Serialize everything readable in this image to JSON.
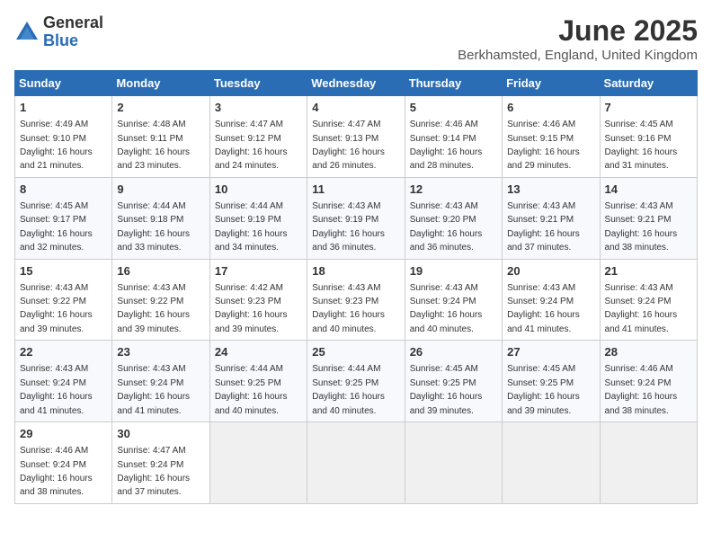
{
  "logo": {
    "general": "General",
    "blue": "Blue"
  },
  "title": "June 2025",
  "location": "Berkhamsted, England, United Kingdom",
  "weekdays": [
    "Sunday",
    "Monday",
    "Tuesday",
    "Wednesday",
    "Thursday",
    "Friday",
    "Saturday"
  ],
  "weeks": [
    [
      {
        "day": "1",
        "info": "Sunrise: 4:49 AM\nSunset: 9:10 PM\nDaylight: 16 hours and 21 minutes."
      },
      {
        "day": "2",
        "info": "Sunrise: 4:48 AM\nSunset: 9:11 PM\nDaylight: 16 hours and 23 minutes."
      },
      {
        "day": "3",
        "info": "Sunrise: 4:47 AM\nSunset: 9:12 PM\nDaylight: 16 hours and 24 minutes."
      },
      {
        "day": "4",
        "info": "Sunrise: 4:47 AM\nSunset: 9:13 PM\nDaylight: 16 hours and 26 minutes."
      },
      {
        "day": "5",
        "info": "Sunrise: 4:46 AM\nSunset: 9:14 PM\nDaylight: 16 hours and 28 minutes."
      },
      {
        "day": "6",
        "info": "Sunrise: 4:46 AM\nSunset: 9:15 PM\nDaylight: 16 hours and 29 minutes."
      },
      {
        "day": "7",
        "info": "Sunrise: 4:45 AM\nSunset: 9:16 PM\nDaylight: 16 hours and 31 minutes."
      }
    ],
    [
      {
        "day": "8",
        "info": "Sunrise: 4:45 AM\nSunset: 9:17 PM\nDaylight: 16 hours and 32 minutes."
      },
      {
        "day": "9",
        "info": "Sunrise: 4:44 AM\nSunset: 9:18 PM\nDaylight: 16 hours and 33 minutes."
      },
      {
        "day": "10",
        "info": "Sunrise: 4:44 AM\nSunset: 9:19 PM\nDaylight: 16 hours and 34 minutes."
      },
      {
        "day": "11",
        "info": "Sunrise: 4:43 AM\nSunset: 9:19 PM\nDaylight: 16 hours and 36 minutes."
      },
      {
        "day": "12",
        "info": "Sunrise: 4:43 AM\nSunset: 9:20 PM\nDaylight: 16 hours and 36 minutes."
      },
      {
        "day": "13",
        "info": "Sunrise: 4:43 AM\nSunset: 9:21 PM\nDaylight: 16 hours and 37 minutes."
      },
      {
        "day": "14",
        "info": "Sunrise: 4:43 AM\nSunset: 9:21 PM\nDaylight: 16 hours and 38 minutes."
      }
    ],
    [
      {
        "day": "15",
        "info": "Sunrise: 4:43 AM\nSunset: 9:22 PM\nDaylight: 16 hours and 39 minutes."
      },
      {
        "day": "16",
        "info": "Sunrise: 4:43 AM\nSunset: 9:22 PM\nDaylight: 16 hours and 39 minutes."
      },
      {
        "day": "17",
        "info": "Sunrise: 4:42 AM\nSunset: 9:23 PM\nDaylight: 16 hours and 39 minutes."
      },
      {
        "day": "18",
        "info": "Sunrise: 4:43 AM\nSunset: 9:23 PM\nDaylight: 16 hours and 40 minutes."
      },
      {
        "day": "19",
        "info": "Sunrise: 4:43 AM\nSunset: 9:24 PM\nDaylight: 16 hours and 40 minutes."
      },
      {
        "day": "20",
        "info": "Sunrise: 4:43 AM\nSunset: 9:24 PM\nDaylight: 16 hours and 41 minutes."
      },
      {
        "day": "21",
        "info": "Sunrise: 4:43 AM\nSunset: 9:24 PM\nDaylight: 16 hours and 41 minutes."
      }
    ],
    [
      {
        "day": "22",
        "info": "Sunrise: 4:43 AM\nSunset: 9:24 PM\nDaylight: 16 hours and 41 minutes."
      },
      {
        "day": "23",
        "info": "Sunrise: 4:43 AM\nSunset: 9:24 PM\nDaylight: 16 hours and 41 minutes."
      },
      {
        "day": "24",
        "info": "Sunrise: 4:44 AM\nSunset: 9:25 PM\nDaylight: 16 hours and 40 minutes."
      },
      {
        "day": "25",
        "info": "Sunrise: 4:44 AM\nSunset: 9:25 PM\nDaylight: 16 hours and 40 minutes."
      },
      {
        "day": "26",
        "info": "Sunrise: 4:45 AM\nSunset: 9:25 PM\nDaylight: 16 hours and 39 minutes."
      },
      {
        "day": "27",
        "info": "Sunrise: 4:45 AM\nSunset: 9:25 PM\nDaylight: 16 hours and 39 minutes."
      },
      {
        "day": "28",
        "info": "Sunrise: 4:46 AM\nSunset: 9:24 PM\nDaylight: 16 hours and 38 minutes."
      }
    ],
    [
      {
        "day": "29",
        "info": "Sunrise: 4:46 AM\nSunset: 9:24 PM\nDaylight: 16 hours and 38 minutes."
      },
      {
        "day": "30",
        "info": "Sunrise: 4:47 AM\nSunset: 9:24 PM\nDaylight: 16 hours and 37 minutes."
      },
      {
        "day": "",
        "info": ""
      },
      {
        "day": "",
        "info": ""
      },
      {
        "day": "",
        "info": ""
      },
      {
        "day": "",
        "info": ""
      },
      {
        "day": "",
        "info": ""
      }
    ]
  ]
}
